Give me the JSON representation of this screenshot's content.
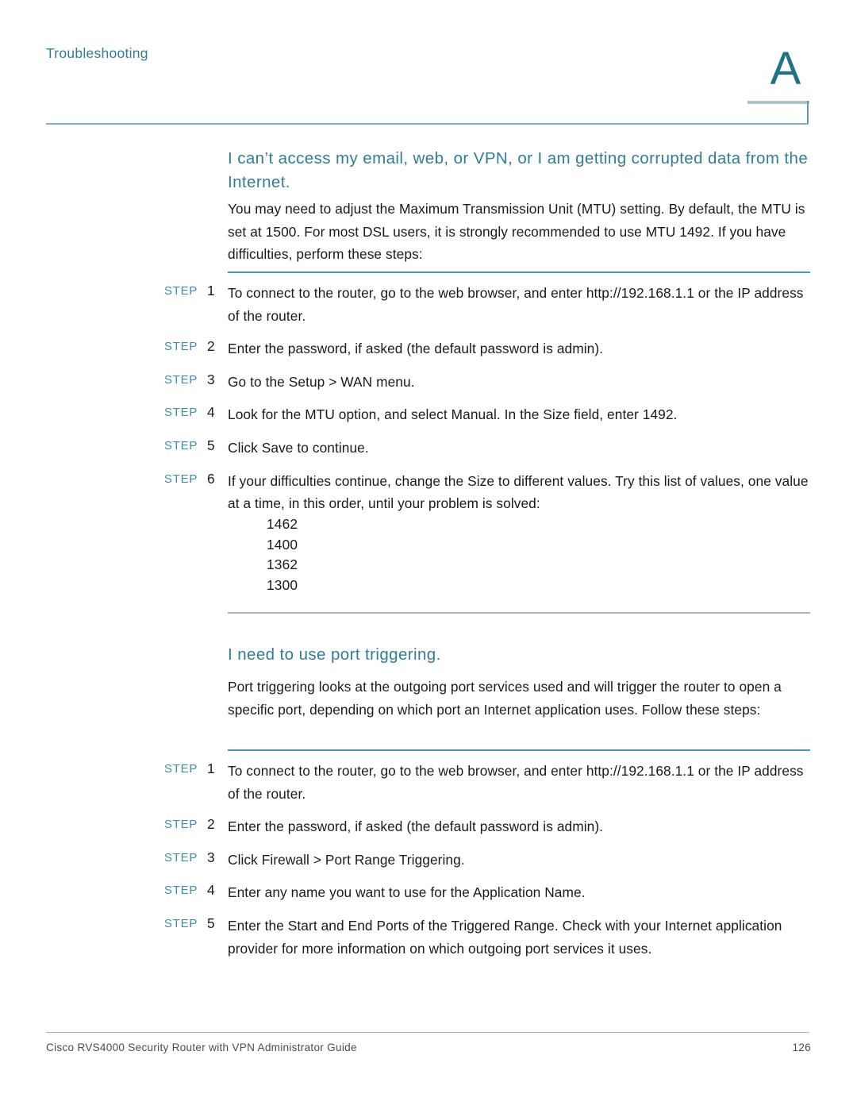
{
  "header": {
    "running_title": "Troubleshooting",
    "appendix_letter": "A"
  },
  "colors": {
    "heading_teal": "#2f7d96",
    "step_label_teal": "#3d8fa5",
    "rule_teal": "#4a9aad",
    "rule_gray": "#b3b3b3",
    "header_rule_blue": "#7fadcf",
    "header_tab_gray_teal": "#a8c6ca",
    "appendix_letter_color": "#1f7386",
    "body_text": "#1a1a1a",
    "footer_text": "#4d4d4d"
  },
  "sections": [
    {
      "heading": "I can’t access my email, web, or VPN, or I am getting corrupted data from the Internet.",
      "paragraph": "You may need to adjust the Maximum Transmission Unit (MTU) setting. By default, the MTU is set at 1500. For most DSL users, it is strongly recommended to use MTU 1492. If you have difficulties, perform these steps:",
      "step_label": "STEP",
      "steps": [
        {
          "number": "1",
          "text": "To connect to the router, go to the web browser, and enter http://192.168.1.1 or the IP address of the router."
        },
        {
          "number": "2",
          "text": "Enter the password, if asked (the default password is admin)."
        },
        {
          "number": "3",
          "text": "Go to the Setup > WAN menu."
        },
        {
          "number": "4",
          "text": "Look for the MTU option, and select Manual. In the Size field, enter 1492."
        },
        {
          "number": "5",
          "text": "Click Save to continue."
        },
        {
          "number": "6",
          "text": "If your difficulties continue, change the Size to different values. Try this list of values, one value at a time, in this order, until your problem is solved:"
        }
      ],
      "value_list": [
        "1462",
        "1400",
        "1362",
        "1300"
      ]
    },
    {
      "heading": "I need to use port triggering.",
      "paragraph": "Port triggering looks at the outgoing port services used and will trigger the router to open a specific port, depending on which port an Internet application uses. Follow these steps:",
      "step_label": "STEP",
      "steps": [
        {
          "number": "1",
          "text": "To connect to the router, go to the web browser, and enter http://192.168.1.1 or the IP address of the router."
        },
        {
          "number": "2",
          "text": "Enter the password, if asked (the default password is admin)."
        },
        {
          "number": "3",
          "text": "Click Firewall > Port Range Triggering."
        },
        {
          "number": "4",
          "text": "Enter any name you want to use for the Application Name."
        },
        {
          "number": "5",
          "text": "Enter the Start and End Ports of the Triggered Range. Check with your Internet application provider for more information on which outgoing port services it uses."
        }
      ]
    }
  ],
  "footer": {
    "guide_title": "Cisco RVS4000 Security Router with VPN Administrator Guide",
    "page_number": "126"
  }
}
